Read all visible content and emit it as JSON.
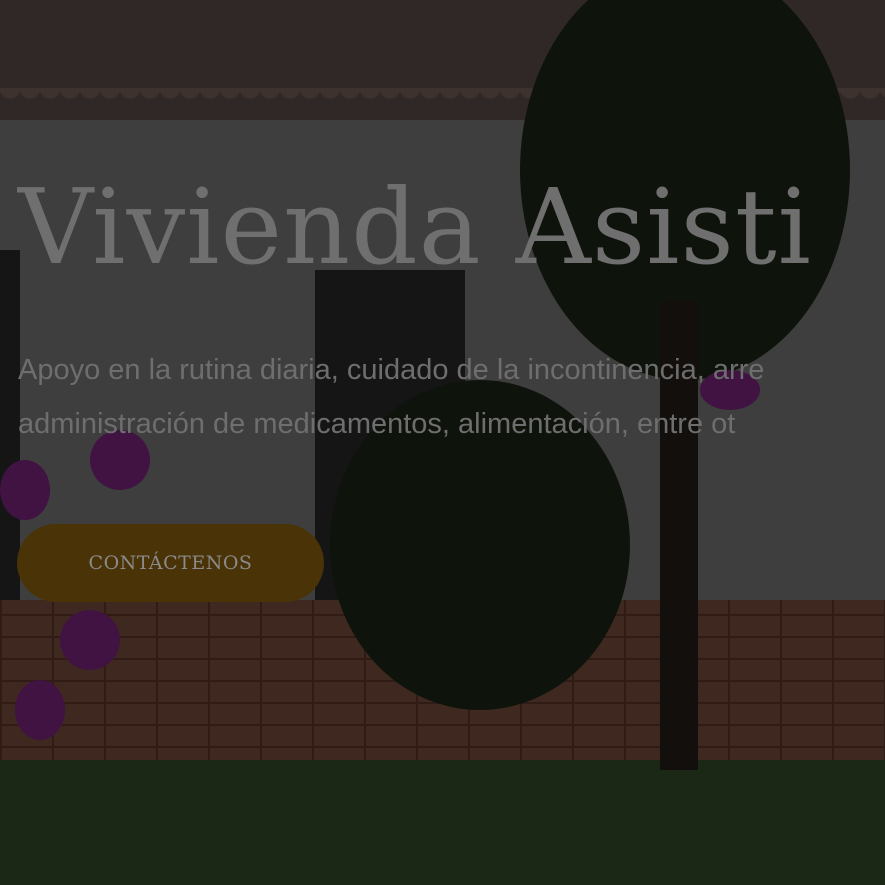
{
  "hero": {
    "title": "Vivienda Asisti",
    "subtitle_line1": "Apoyo en la rutina diaria, cuidado de la incontinencia, arre",
    "subtitle_line2": "administración de medicamentos, alimentación, entre ot",
    "cta_label": "CONTÁCTENOS"
  },
  "colors": {
    "cta_background": "#4a3306",
    "overlay": "rgba(0,0,0,0.55)",
    "text": "#6f6f6f"
  }
}
